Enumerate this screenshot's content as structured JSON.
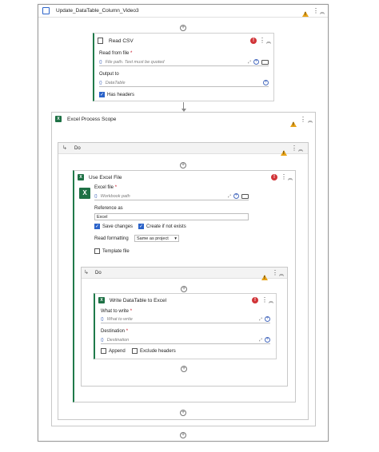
{
  "sequence": {
    "title": "Update_DataTable_Column_Video3"
  },
  "read_csv": {
    "title": "Read CSV",
    "read_from_file_label": "Read from file",
    "read_from_file_placeholder": "File path. Text must be quoted",
    "output_label": "Output to",
    "output_placeholder": "DataTable",
    "has_headers_label": "Has headers",
    "has_headers_checked": true
  },
  "excel_scope": {
    "title": "Excel Process Scope",
    "do_label": "Do"
  },
  "use_excel": {
    "title": "Use Excel File",
    "excel_file_label": "Excel file",
    "excel_file_placeholder": "Workbook path",
    "reference_label": "Reference as",
    "reference_value": "Excel",
    "save_changes_label": "Save changes",
    "create_label": "Create if not exists",
    "read_formatting_label": "Read formatting",
    "read_formatting_value": "Same as project",
    "template_label": "Template file",
    "do_label": "Do"
  },
  "write_dt": {
    "title": "Write DataTable to Excel",
    "what_label": "What to write",
    "what_placeholder": "What to write",
    "dest_label": "Destination",
    "dest_placeholder": "Destination",
    "append_label": "Append",
    "exclude_label": "Exclude headers"
  },
  "glyphs": {
    "brace": "{}",
    "plus": "+",
    "expand": "⤢",
    "kebab": "⋮",
    "collapse": "︽",
    "do_arrow": "↳",
    "check": "✓",
    "chevron": "▾"
  },
  "colors": {
    "excel_green": "#1e7145",
    "warning": "#e8a317",
    "error": "#d13438",
    "checkbox_on": "#2b63c9"
  }
}
